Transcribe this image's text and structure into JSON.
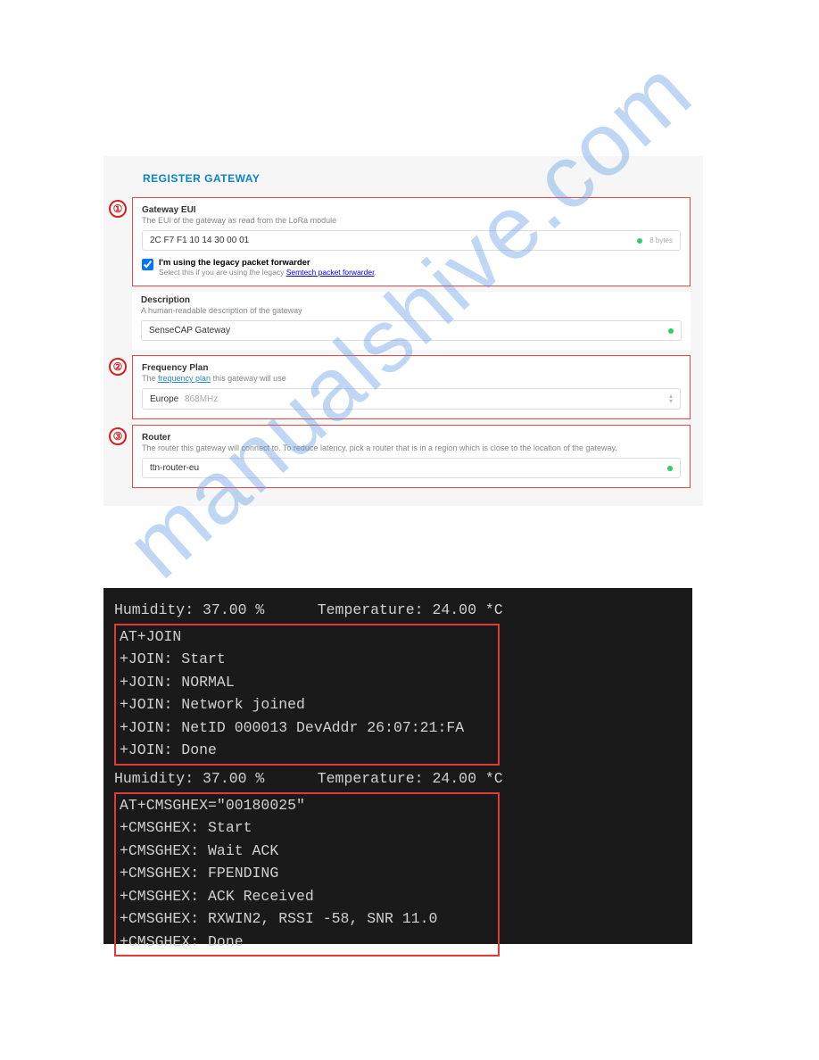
{
  "watermark": "manualshive.com",
  "form": {
    "title": "REGISTER GATEWAY",
    "marker1": "①",
    "marker2": "②",
    "marker3": "③",
    "eui": {
      "label": "Gateway EUI",
      "sub": "The EUI of the gateway as read from the LoRa module",
      "value": "2C F7 F1 10 14 30 00 01",
      "bytes": "8 bytes"
    },
    "legacy": {
      "label": "I'm using the legacy packet forwarder",
      "sub_pre": "Select this if you are using the legacy ",
      "sub_link": "Semtech packet forwarder",
      "sub_post": "."
    },
    "desc": {
      "label": "Description",
      "sub": "A human-readable description of the gateway",
      "value": "SenseCAP Gateway"
    },
    "freq": {
      "label": "Frequency Plan",
      "sub_pre": "The ",
      "sub_link": "frequency plan",
      "sub_post": " this gateway will use",
      "value": "Europe",
      "faint": "868MHz"
    },
    "router": {
      "label": "Router",
      "sub": "The router this gateway will connect to. To reduce latency, pick a router that is in a region which is close to the location of the gateway.",
      "value": "ttn-router-eu"
    }
  },
  "term": {
    "hdr1": "Humidity: 37.00 %      Temperature: 24.00 *C",
    "box1": [
      "AT+JOIN",
      "+JOIN: Start",
      "+JOIN: NORMAL",
      "+JOIN: Network joined",
      "+JOIN: NetID 000013 DevAddr 26:07:21:FA",
      "+JOIN: Done"
    ],
    "hdr2": "Humidity: 37.00 %      Temperature: 24.00 *C",
    "box2": [
      "AT+CMSGHEX=\"00180025\"",
      "+CMSGHEX: Start",
      "+CMSGHEX: Wait ACK",
      "+CMSGHEX: FPENDING",
      "+CMSGHEX: ACK Received",
      "+CMSGHEX: RXWIN2, RSSI -58, SNR 11.0",
      "+CMSGHEX: Done"
    ]
  }
}
